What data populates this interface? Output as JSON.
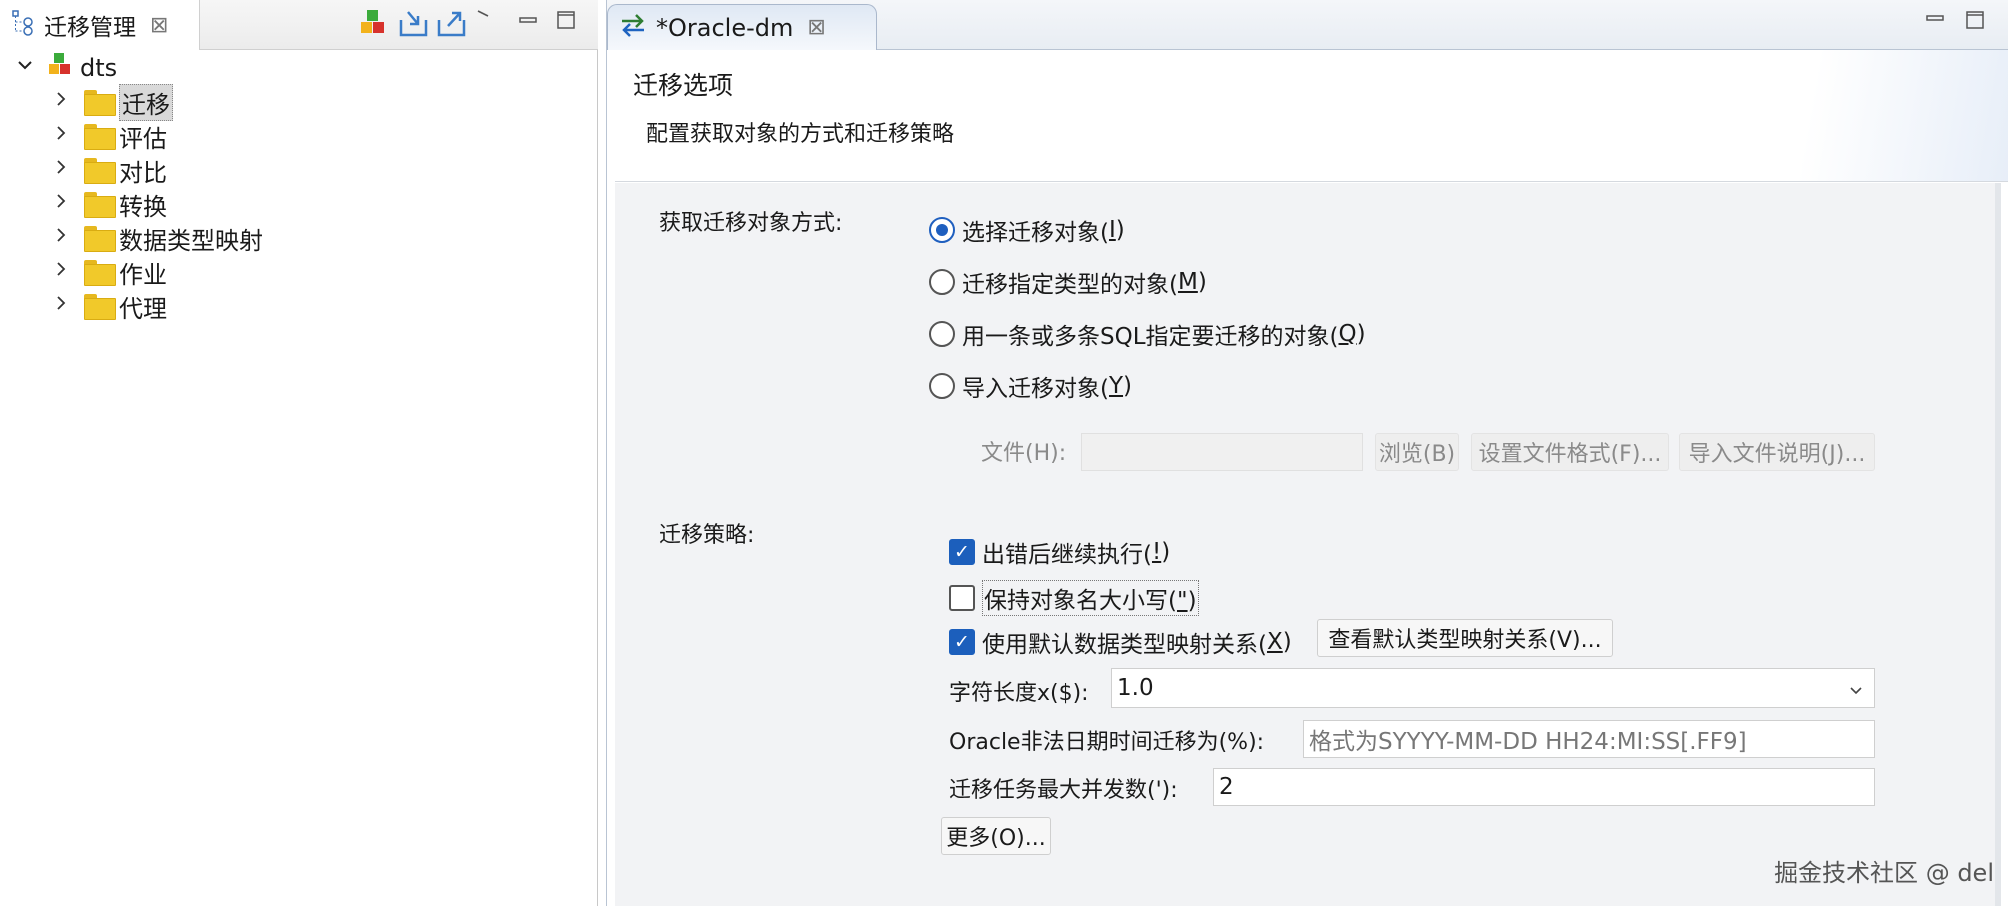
{
  "left": {
    "tab": {
      "title": "迁移管理",
      "close": "⊠"
    },
    "tree": {
      "root": "dts",
      "items": [
        {
          "label": "迁移",
          "selected": true
        },
        {
          "label": "评估"
        },
        {
          "label": "对比"
        },
        {
          "label": "转换"
        },
        {
          "label": "数据类型映射"
        },
        {
          "label": "作业"
        },
        {
          "label": "代理"
        }
      ]
    }
  },
  "editor": {
    "tab": {
      "title": "*Oracle-dm",
      "close": "⊠"
    },
    "page_title": "迁移选项",
    "page_subtitle": "配置获取对象的方式和迁移策略",
    "acquire_label": "获取迁移对象方式:",
    "radios": [
      {
        "text": "选择迁移对象(",
        "mnemonic": "I",
        "suffix": ")",
        "selected": true
      },
      {
        "text": "迁移指定类型的对象(",
        "mnemonic": "M",
        "suffix": ")"
      },
      {
        "text": "用一条或多条SQL指定要迁移的对象(",
        "mnemonic": "Q",
        "suffix": ")"
      },
      {
        "text": "导入迁移对象(",
        "mnemonic": "Y",
        "suffix": ")"
      }
    ],
    "file_label": "文件(H):",
    "browse_button": "浏览(B)",
    "file_format_button": "设置文件格式(F)...",
    "import_desc_button": "导入文件说明(J)...",
    "strategy_label": "迁移策略:",
    "checkboxes": [
      {
        "text": "出错后继续执行(",
        "mnemonic": "!",
        "suffix": ")",
        "checked": true
      },
      {
        "text": "保持对象名大小写(",
        "mnemonic": "\"",
        "suffix": ")",
        "checked": false
      },
      {
        "text": "使用默认数据类型映射关系(",
        "mnemonic": "X",
        "suffix": ")",
        "checked": true
      }
    ],
    "view_mapping_button": "查看默认类型映射关系(V)...",
    "char_length_label": "字符长度x($):",
    "char_length_value": "1.0",
    "illegal_date_label": "Oracle非法日期时间迁移为(%):",
    "illegal_date_placeholder": "格式为SYYYY-MM-DD HH24:MI:SS[.FF9]",
    "max_concurrency_label": "迁移任务最大并发数('):",
    "max_concurrency_value": "2",
    "more_button": "更多(O)..."
  },
  "watermark": "掘金技术社区 @ del"
}
